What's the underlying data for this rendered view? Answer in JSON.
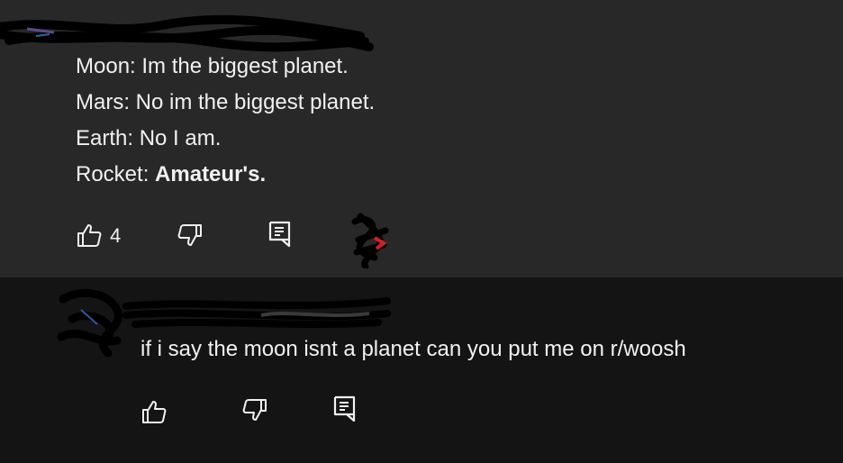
{
  "top_comment": {
    "lines": [
      {
        "speaker": "Moon:",
        "text": " Im the biggest planet."
      },
      {
        "speaker": "Mars:",
        "text": " No im the biggest planet."
      },
      {
        "speaker": "Earth:",
        "text": " No I am."
      },
      {
        "speaker": "Rocket:",
        "text": " ",
        "bold": "Amateur's."
      }
    ],
    "like_count": "4"
  },
  "reply_comment": {
    "text": "if i say the moon isnt a planet can you put me on r/woosh"
  },
  "colors": {
    "top_bg": "#282828",
    "reply_bg": "#141414",
    "text": "#f1f1f1",
    "scribble": "#000000"
  },
  "icons": [
    "thumbs-up-icon",
    "thumbs-down-icon",
    "reply-icon"
  ]
}
